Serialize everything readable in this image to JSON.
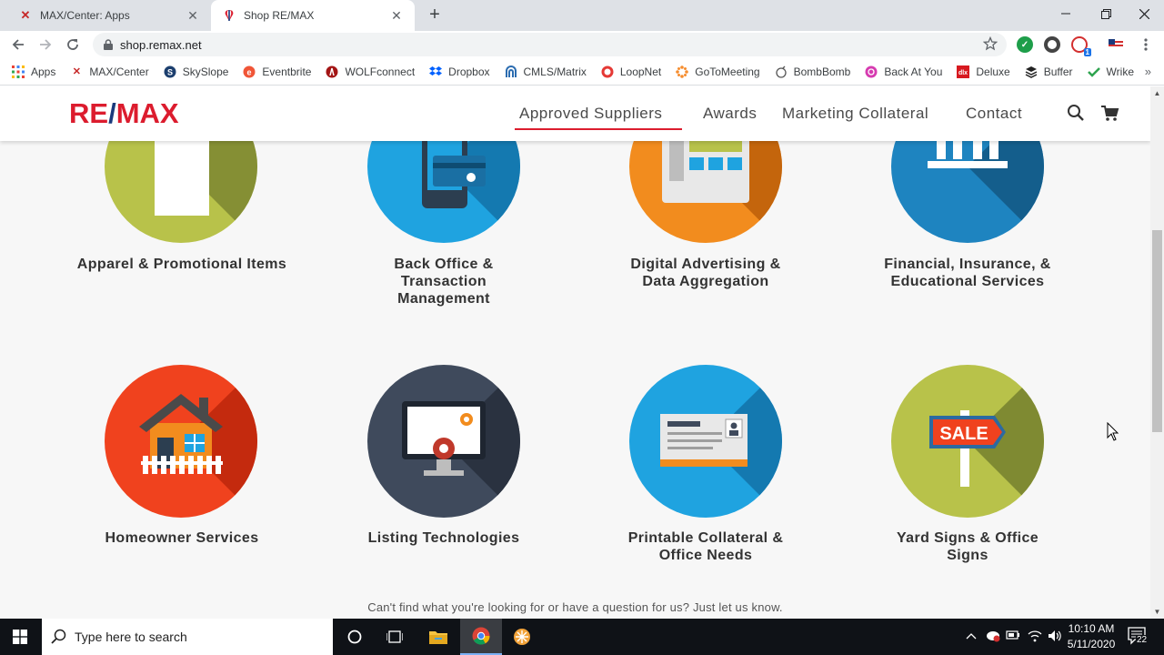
{
  "browser": {
    "tabs": [
      {
        "title": "MAX/Center: Apps",
        "active": false
      },
      {
        "title": "Shop RE/MAX",
        "active": true
      }
    ],
    "new_tab_label": "+",
    "address": "shop.remax.net",
    "bookmarks": [
      {
        "label": "Apps",
        "icon": "apps-grid-icon"
      },
      {
        "label": "MAX/Center",
        "icon": "remax-x-icon"
      },
      {
        "label": "SkySlope",
        "icon": "skyslope-icon"
      },
      {
        "label": "Eventbrite",
        "icon": "eventbrite-icon"
      },
      {
        "label": "WOLFconnect",
        "icon": "wolfconnect-icon"
      },
      {
        "label": "Dropbox",
        "icon": "dropbox-icon"
      },
      {
        "label": "CMLS/Matrix",
        "icon": "matrix-icon"
      },
      {
        "label": "LoopNet",
        "icon": "loopnet-icon"
      },
      {
        "label": "GoToMeeting",
        "icon": "gotomeeting-icon"
      },
      {
        "label": "BombBomb",
        "icon": "bombbomb-icon"
      },
      {
        "label": "Back At You",
        "icon": "backatyou-icon"
      },
      {
        "label": "Deluxe",
        "icon": "deluxe-icon"
      },
      {
        "label": "Buffer",
        "icon": "buffer-icon"
      },
      {
        "label": "Wrike",
        "icon": "wrike-icon"
      }
    ],
    "extension_badge": "1"
  },
  "site": {
    "logo_left": "RE",
    "logo_slash": "/",
    "logo_right": "MAX",
    "nav": [
      {
        "label": "Approved Suppliers",
        "active": true
      },
      {
        "label": "Awards",
        "active": false
      },
      {
        "label": "Marketing Collateral",
        "active": false
      },
      {
        "label": "Contact",
        "active": false
      }
    ],
    "categories": [
      {
        "label": "Apparel & Promotional Items",
        "color": "#b8c24a",
        "shade": "#7f8a32"
      },
      {
        "label": "Back Office & Transaction Management",
        "color": "#1fa3e0",
        "shade": "#1479b0"
      },
      {
        "label": "Digital Advertising & Data Aggregation",
        "color": "#f28c1e",
        "shade": "#c4650c"
      },
      {
        "label": "Financial, Insurance, & Educational Services",
        "color": "#1e84c0",
        "shade": "#145e8c"
      },
      {
        "label": "Homeowner Services",
        "color": "#f0421e",
        "shade": "#c42a0e"
      },
      {
        "label": "Listing Technologies",
        "color": "#3f4a5c",
        "shade": "#2a3240"
      },
      {
        "label": "Printable Collateral & Office Needs",
        "color": "#1fa3e0",
        "shade": "#1479b0"
      },
      {
        "label": "Yard Signs & Office Signs",
        "color": "#b8c24a",
        "shade": "#7f8a32"
      }
    ],
    "footer_text": "Can't find what you're looking for or have a question for us? Just let us know."
  },
  "taskbar": {
    "search_placeholder": "Type here to search",
    "time": "10:10 AM",
    "date": "5/11/2020",
    "notifications": "22"
  },
  "colors": {
    "brand_red": "#dc1c2e",
    "brand_blue": "#1a3a7c"
  }
}
